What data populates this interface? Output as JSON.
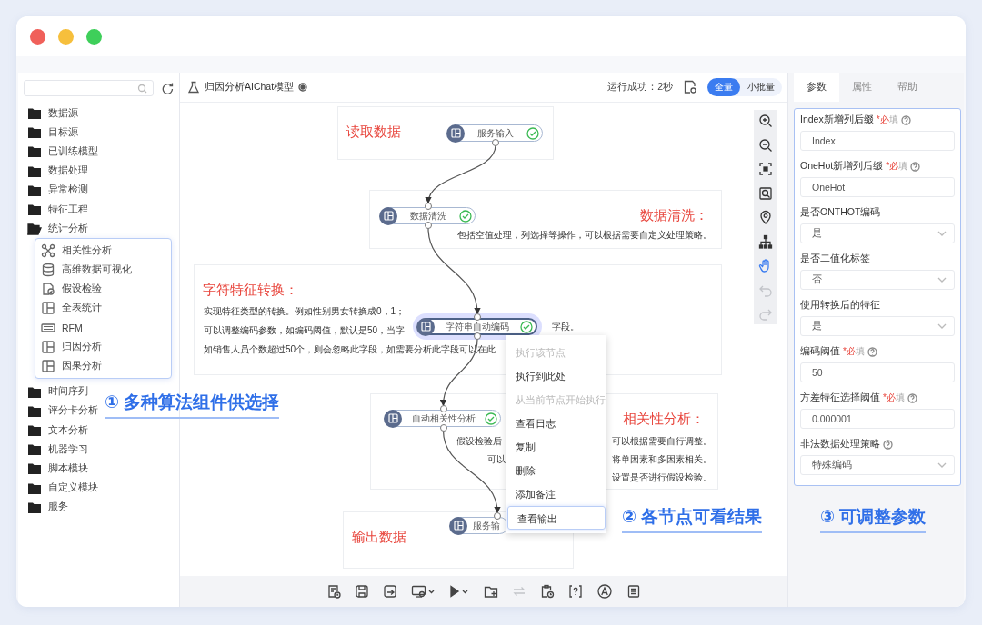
{
  "window": {
    "controls": [
      {
        "kind": "close"
      },
      {
        "kind": "minimize"
      },
      {
        "kind": "maximize"
      }
    ]
  },
  "sidebar": {
    "tree": [
      {
        "label": "数据源",
        "expanded": false
      },
      {
        "label": "目标源",
        "expanded": false
      },
      {
        "label": "已训练模型",
        "expanded": false
      },
      {
        "label": "数据处理",
        "expanded": false
      },
      {
        "label": "异常检测",
        "expanded": false
      },
      {
        "label": "特征工程",
        "expanded": false
      },
      {
        "label": "统计分析",
        "expanded": true,
        "children": [
          {
            "label": "相关性分析",
            "kind": "network"
          },
          {
            "label": "高维数据可视化",
            "kind": "database"
          },
          {
            "label": "假设检验",
            "kind": "test"
          },
          {
            "label": "全表统计",
            "kind": "layout"
          },
          {
            "label": "RFM",
            "kind": "rfm"
          },
          {
            "label": "归因分析",
            "kind": "layout"
          },
          {
            "label": "因果分析",
            "kind": "layout"
          }
        ]
      },
      {
        "label": "时间序列",
        "expanded": false
      },
      {
        "label": "评分卡分析",
        "expanded": false
      },
      {
        "label": "文本分析",
        "expanded": false
      },
      {
        "label": "机器学习",
        "expanded": false
      },
      {
        "label": "脚本模块",
        "expanded": false
      },
      {
        "label": "自定义模块",
        "expanded": false
      },
      {
        "label": "服务",
        "expanded": false
      }
    ]
  },
  "canvas": {
    "title": "归因分析AIChat模型",
    "status": "运行成功：2秒",
    "modes": [
      {
        "label": "全量",
        "selected": true
      },
      {
        "label": "小批量",
        "selected": false
      }
    ],
    "notes": [
      {
        "title": "读取数据"
      },
      {
        "title": "数据清洗：",
        "texts": [
          "包括空值处理，列选择等操作，可以根据需要自定义处理策略。"
        ]
      },
      {
        "title": "字符特征转换：",
        "texts": [
          "实现特征类型的转换。例如性别男女转换成0，1；",
          "可以调整编码参数，如编码阈值，默认是50，当字",
          "字段。",
          "如销售人员个数超过50个，则会忽略此字段，如需要分析此字段可以在此"
        ]
      },
      {
        "title": "相关性分析：",
        "texts": [
          "假设检验后",
          "可以",
          "可以根据需要自行调整。",
          "将单因素和多因素相关。",
          "设置是否进行假设检验。"
        ]
      },
      {
        "title": "输出数据"
      }
    ],
    "nodes": [
      {
        "label": "服务输入",
        "succeeded": true,
        "selected": false
      },
      {
        "label": "数据清洗",
        "succeeded": true,
        "selected": false
      },
      {
        "label": "字符串自动编码",
        "succeeded": true,
        "selected": true
      },
      {
        "label": "自动相关性分析",
        "succeeded": true,
        "selected": false
      },
      {
        "label": "服务输",
        "selected": false
      }
    ],
    "context_menu": [
      {
        "label": "执行该节点",
        "disabled": true,
        "selected": false
      },
      {
        "label": "执行到此处",
        "disabled": false,
        "selected": false
      },
      {
        "label": "从当前节点开始执行",
        "disabled": true,
        "selected": false
      },
      {
        "label": "查看日志",
        "disabled": false,
        "selected": false
      },
      {
        "label": "复制",
        "disabled": false,
        "selected": false
      },
      {
        "label": "删除",
        "disabled": false,
        "selected": false
      },
      {
        "label": "添加备注",
        "disabled": false,
        "selected": false
      },
      {
        "label": "查看输出",
        "disabled": false,
        "selected": true
      }
    ],
    "tools": [
      {
        "kind": "zoom_in",
        "selected": false,
        "disabled": false
      },
      {
        "kind": "zoom_out",
        "selected": false,
        "disabled": false
      },
      {
        "kind": "fit",
        "selected": false,
        "disabled": false
      },
      {
        "kind": "zoom_box",
        "selected": false,
        "disabled": false
      },
      {
        "kind": "locate",
        "selected": false,
        "disabled": false
      },
      {
        "kind": "tree",
        "selected": false,
        "disabled": false
      },
      {
        "kind": "pan",
        "selected": true,
        "disabled": false
      },
      {
        "kind": "undo",
        "selected": false,
        "disabled": true
      },
      {
        "kind": "redo",
        "selected": false,
        "disabled": true
      }
    ],
    "toolbar": [
      {
        "kind": "report",
        "disabled": false
      },
      {
        "kind": "save",
        "disabled": false
      },
      {
        "kind": "save_as",
        "disabled": false
      },
      {
        "kind": "monitor",
        "disabled": false
      },
      {
        "kind": "run",
        "disabled": false
      },
      {
        "kind": "folder_add",
        "disabled": false
      },
      {
        "kind": "swap",
        "disabled": true
      },
      {
        "kind": "schedule",
        "disabled": false
      },
      {
        "kind": "help",
        "disabled": false
      },
      {
        "kind": "annotate",
        "disabled": false
      },
      {
        "kind": "log",
        "disabled": false
      }
    ]
  },
  "panel": {
    "tabs": [
      {
        "label": "参数",
        "selected": true
      },
      {
        "label": "属性",
        "selected": false
      },
      {
        "label": "帮助",
        "selected": false
      }
    ],
    "fields": [
      {
        "label": "Index新增列后缀",
        "required": "*必填",
        "help": true,
        "kind": "input",
        "value": "Index"
      },
      {
        "label": "OneHot新增列后缀",
        "required": "*必填",
        "help": true,
        "kind": "input",
        "value": "OneHot"
      },
      {
        "label": "是否ONTHOT编码",
        "help": false,
        "kind": "select",
        "value": "是"
      },
      {
        "label": "是否二值化标签",
        "help": false,
        "kind": "select",
        "value": "否"
      },
      {
        "label": "使用转换后的特征",
        "help": false,
        "kind": "select",
        "value": "是"
      },
      {
        "label": "编码阈值",
        "required": "*必填",
        "help": true,
        "kind": "input",
        "value": "50"
      },
      {
        "label": "方差特征选择阈值",
        "required": "*必填",
        "help": true,
        "kind": "input",
        "value": "0.000001"
      },
      {
        "label": "非法数据处理策略",
        "help": true,
        "kind": "select",
        "value": "特殊编码"
      }
    ]
  },
  "callouts": [
    "① 多种算法组件供选择",
    "② 各节点可看结果",
    "③ 可调整参数"
  ]
}
